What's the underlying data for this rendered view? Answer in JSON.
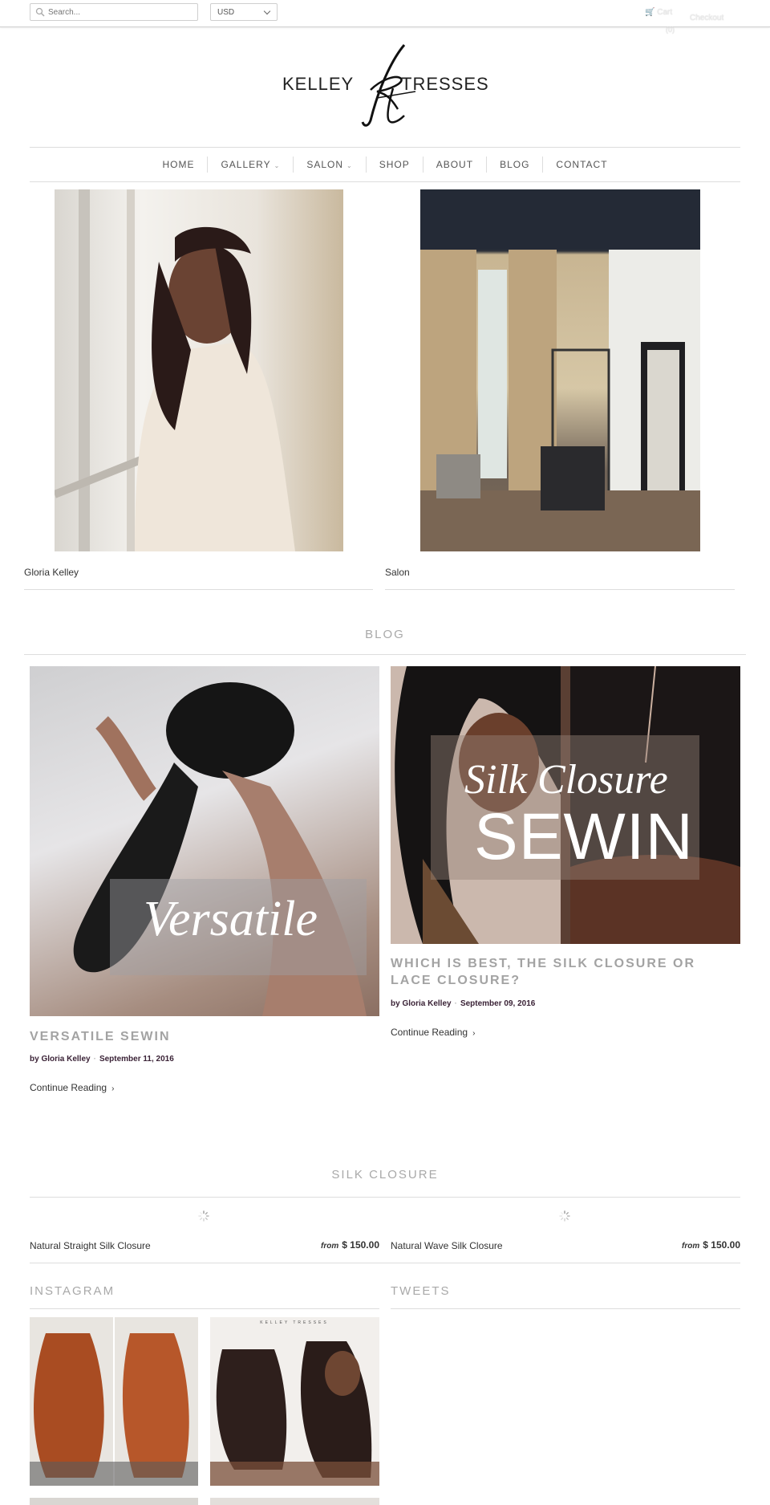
{
  "topbar": {
    "search_placeholder": "Search...",
    "currency": "USD",
    "cart_label": "Cart",
    "cart_count": "(0)",
    "checkout_label": "Checkout"
  },
  "logo": {
    "left": "KELLEY",
    "right": "TRESSES",
    "monogram": "kt"
  },
  "nav": [
    {
      "label": "HOME",
      "dropdown": false
    },
    {
      "label": "GALLERY",
      "dropdown": true
    },
    {
      "label": "SALON",
      "dropdown": true
    },
    {
      "label": "SHOP",
      "dropdown": false
    },
    {
      "label": "ABOUT",
      "dropdown": false
    },
    {
      "label": "BLOG",
      "dropdown": false
    },
    {
      "label": "CONTACT",
      "dropdown": false
    }
  ],
  "featured": [
    {
      "caption": "Gloria Kelley"
    },
    {
      "caption": "Salon"
    }
  ],
  "blog": {
    "title": "BLOG",
    "posts": [
      {
        "title": "VERSATILE SEWIN",
        "overlay": "Versatile",
        "author": "by Gloria Kelley",
        "date": "September 11, 2016",
        "read_more": "Continue Reading"
      },
      {
        "title": "WHICH IS BEST, THE SILK CLOSURE OR LACE CLOSURE?",
        "overlay_top": "Silk Closure",
        "overlay_bottom": "SEWIN",
        "author": "by Gloria Kelley",
        "date": "September 09, 2016",
        "read_more": "Continue Reading"
      }
    ]
  },
  "products": {
    "title": "SILK CLOSURE",
    "items": [
      {
        "name": "Natural Straight Silk Closure",
        "from": "from",
        "price": "$ 150.00"
      },
      {
        "name": "Natural Wave Silk Closure",
        "from": "from",
        "price": "$ 150.00"
      }
    ]
  },
  "instagram": {
    "title": "INSTAGRAM",
    "watermark": "KELLEY TRESSES"
  },
  "tweets": {
    "title": "TWEETS"
  },
  "colors": {
    "accent_text": "#3a2236",
    "muted_heading": "#a9a9a9",
    "divider": "#dddddd"
  }
}
